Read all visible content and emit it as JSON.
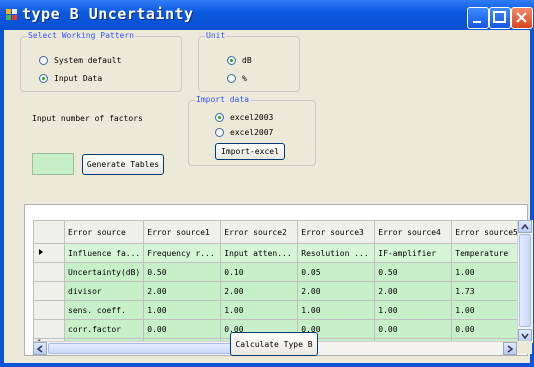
{
  "window": {
    "title": "type B Uncertainty"
  },
  "pattern_group": {
    "label": "Select Working Pattern",
    "options": [
      {
        "label": "System default",
        "selected": false
      },
      {
        "label": "Input Data",
        "selected": true
      }
    ]
  },
  "unit_group": {
    "label": "Unit",
    "options": [
      {
        "label": "dB",
        "selected": true
      },
      {
        "label": "%",
        "selected": false
      }
    ]
  },
  "factors": {
    "label": "Input number of factors",
    "value": "",
    "generate_button": "Generate Tables"
  },
  "import_group": {
    "label": "Import data",
    "options": [
      {
        "label": "excel2003",
        "selected": true
      },
      {
        "label": "excel2007",
        "selected": false
      }
    ],
    "import_button": "Import-excel"
  },
  "grid": {
    "columns": [
      "Error source",
      "Error source1",
      "Error source2",
      "Error source3",
      "Error source4",
      "Error source5"
    ],
    "rows": [
      [
        "Influence fa...",
        "Frequency r...",
        "Input atten...",
        "Resolution ...",
        "IF-amplifier",
        "Temperature"
      ],
      [
        "Uncertainty(dB)",
        "0.50",
        "0.10",
        "0.05",
        "0.50",
        "1.00"
      ],
      [
        "divisor",
        "2.00",
        "2.00",
        "2.00",
        "2.00",
        "1.73"
      ],
      [
        "sens. coeff.",
        "1.00",
        "1.00",
        "1.00",
        "1.00",
        "1.00"
      ],
      [
        "corr.factor",
        "0.00",
        "0.00",
        "0.00",
        "0.00",
        "0.00"
      ]
    ],
    "new_row_marker": "*"
  },
  "calculate_button": "Calculate Type B",
  "colors": {
    "titlebar": "#0b5ae0",
    "group_label": "#3355ff",
    "cell_green": "#c8f0c8"
  }
}
